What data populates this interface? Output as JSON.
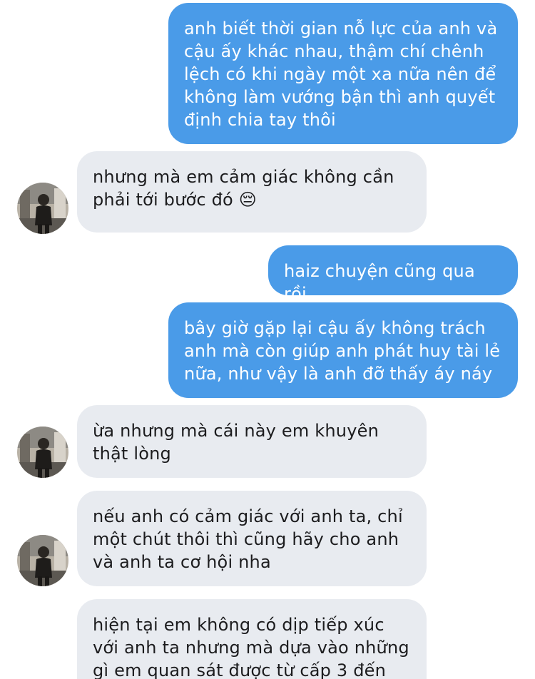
{
  "messages": [
    {
      "direction": "outgoing",
      "text": "anh biết thời gian nỗ lực của anh và\ncậu ấy khác nhau, thậm chí chênh\nlệch có khi ngày một xa nữa nên để\nkhông làm vướng bận thì anh quyết\nđịnh chia tay thôi"
    },
    {
      "direction": "incoming",
      "text": "nhưng mà em cảm giác không cần\nphải tới bước đó 😔"
    },
    {
      "direction": "outgoing",
      "text": "haiz chuyện cũng qua rồi"
    },
    {
      "direction": "outgoing",
      "text": "bây giờ gặp lại cậu ấy không trách\nanh mà còn giúp anh phát huy tài lẻ\nnữa, như vậy là anh đỡ thấy áy náy"
    },
    {
      "direction": "incoming",
      "text": "ừa nhưng mà cái này em khuyên\nthật lòng"
    },
    {
      "direction": "incoming",
      "text": "nếu anh có cảm giác với anh ta, chỉ\nmột chút thôi thì cũng hãy cho anh\nvà anh ta cơ hội nha"
    },
    {
      "direction": "incoming",
      "text": "hiện tại em không có dịp tiếp xúc\nvới anh ta nhưng mà dựa vào những\ngì em quan sát được từ cấp 3 đến"
    }
  ],
  "colors": {
    "outgoing_bubble": "#4a9be8",
    "incoming_bubble": "#e8ebf0",
    "outgoing_text": "#ffffff",
    "incoming_text": "#1c1c1e"
  },
  "icons": {
    "avatar": "contact-photo-avatar"
  }
}
